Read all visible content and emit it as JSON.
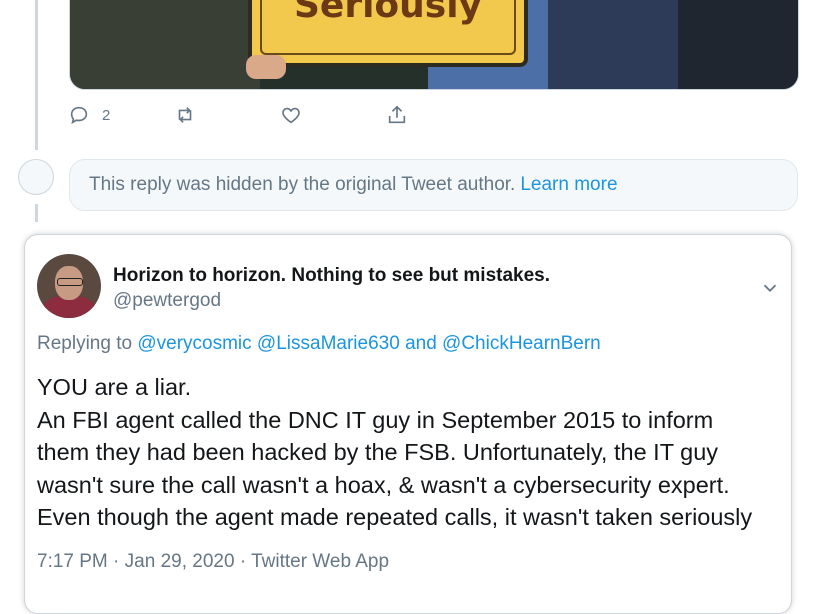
{
  "media": {
    "sign_text": "Seriously"
  },
  "actions": {
    "reply_count": "2"
  },
  "hidden_reply": {
    "message": "This reply was hidden by the original Tweet author.",
    "link": "Learn more"
  },
  "tweet": {
    "name": "Horizon to horizon. Nothing to see but mistakes.",
    "handle": "@pewtergod",
    "replying_prefix": "Replying to",
    "reply_users": [
      "@verycosmic",
      "@LissaMarie630",
      "@ChickHearnBern"
    ],
    "reply_and": "and",
    "body_lines": [
      "YOU are a liar.",
      "An FBI agent called the DNC IT guy in September 2015 to inform",
      "them they had been hacked by the FSB. Unfortunately, the IT guy",
      "wasn't sure the call wasn't a hoax, & wasn't a cybersecurity expert.",
      "Even though the agent made repeated calls, it wasn't taken seriously"
    ],
    "time": "7:17 PM",
    "date": "Jan 29, 2020",
    "source": "Twitter Web App",
    "separator": "·"
  },
  "colors": {
    "link": "#1b95e0",
    "muted": "#657786",
    "border": "#ccd6dd"
  },
  "icons": [
    "reply-icon",
    "retweet-icon",
    "like-icon",
    "share-icon",
    "chevron-down-icon"
  ]
}
